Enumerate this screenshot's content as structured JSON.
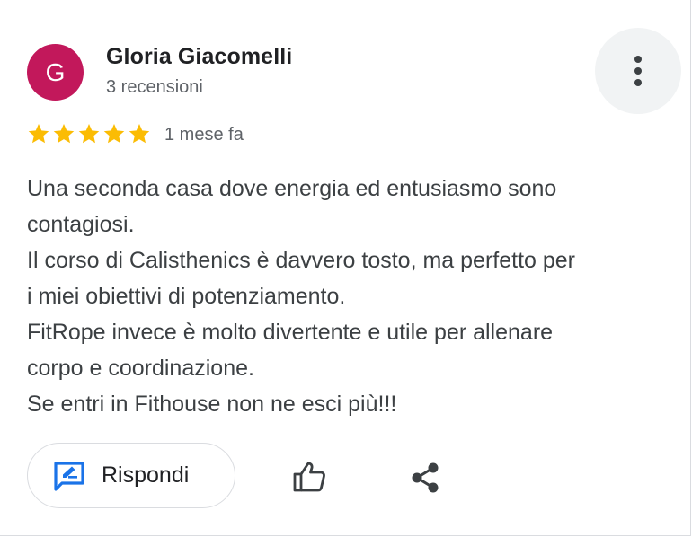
{
  "reviewer": {
    "avatar_letter": "G",
    "avatar_color": "#c2185b",
    "name": "Gloria Giacomelli",
    "review_count": "3 recensioni"
  },
  "rating": {
    "stars": 5,
    "max_stars": 5,
    "star_color": "#fbbc04",
    "date": "1 mese fa"
  },
  "review_text": [
    "Una seconda casa dove energia ed entusiasmo sono",
    "contagiosi.",
    "Il corso di Calisthenics è davvero tosto, ma perfetto per",
    "i miei obiettivi di potenziamento.",
    "FitRope invece è molto divertente e utile per allenare",
    "corpo e coordinazione.",
    "Se entri in Fithouse non ne esci più!!!"
  ],
  "actions": {
    "reply_label": "Rispondi",
    "reply_icon": "reply-edit-icon",
    "like_icon": "thumb-up-icon",
    "share_icon": "share-icon",
    "more_icon": "more-vert-icon",
    "accent_color": "#1a73e8"
  }
}
